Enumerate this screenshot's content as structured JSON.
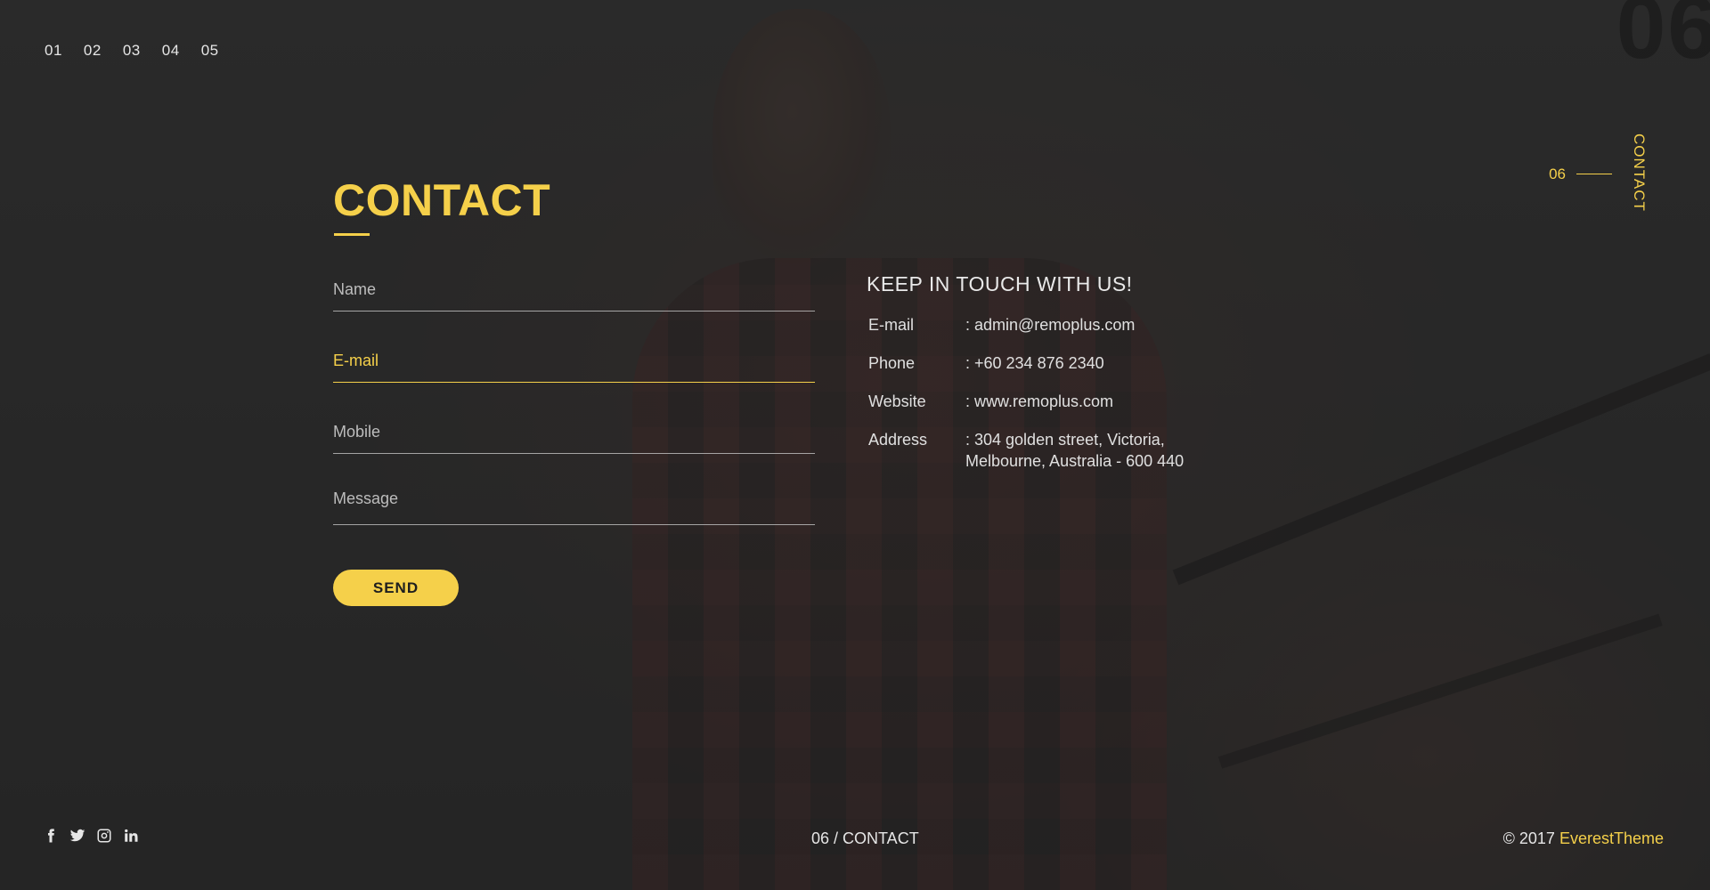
{
  "nav": {
    "items": [
      "01",
      "02",
      "03",
      "04",
      "05"
    ]
  },
  "big_number": "06",
  "side_indicator": {
    "number": "06",
    "label": "CONTACT"
  },
  "contact": {
    "title": "CONTACT"
  },
  "form": {
    "name_placeholder": "Name",
    "email_placeholder": "E-mail",
    "mobile_placeholder": "Mobile",
    "message_placeholder": "Message",
    "send_label": "SEND"
  },
  "info": {
    "heading": "KEEP IN TOUCH WITH US!",
    "rows": [
      {
        "label": "E-mail",
        "value": ": admin@remoplus.com"
      },
      {
        "label": "Phone",
        "value": ": +60 234 876 2340"
      },
      {
        "label": "Website",
        "value": ": www.remoplus.com"
      },
      {
        "label": "Address",
        "value": ": 304 golden street, Victoria,\n  Melbourne, Australia - 600 440"
      }
    ]
  },
  "footer": {
    "social": [
      "facebook-icon",
      "twitter-icon",
      "instagram-icon",
      "linkedin-icon"
    ],
    "section": "06 / CONTACT",
    "copyright_prefix": "© 2017 ",
    "brand": "EverestTheme"
  },
  "colors": {
    "accent": "#f5d04a",
    "background": "#2b2b2b"
  }
}
